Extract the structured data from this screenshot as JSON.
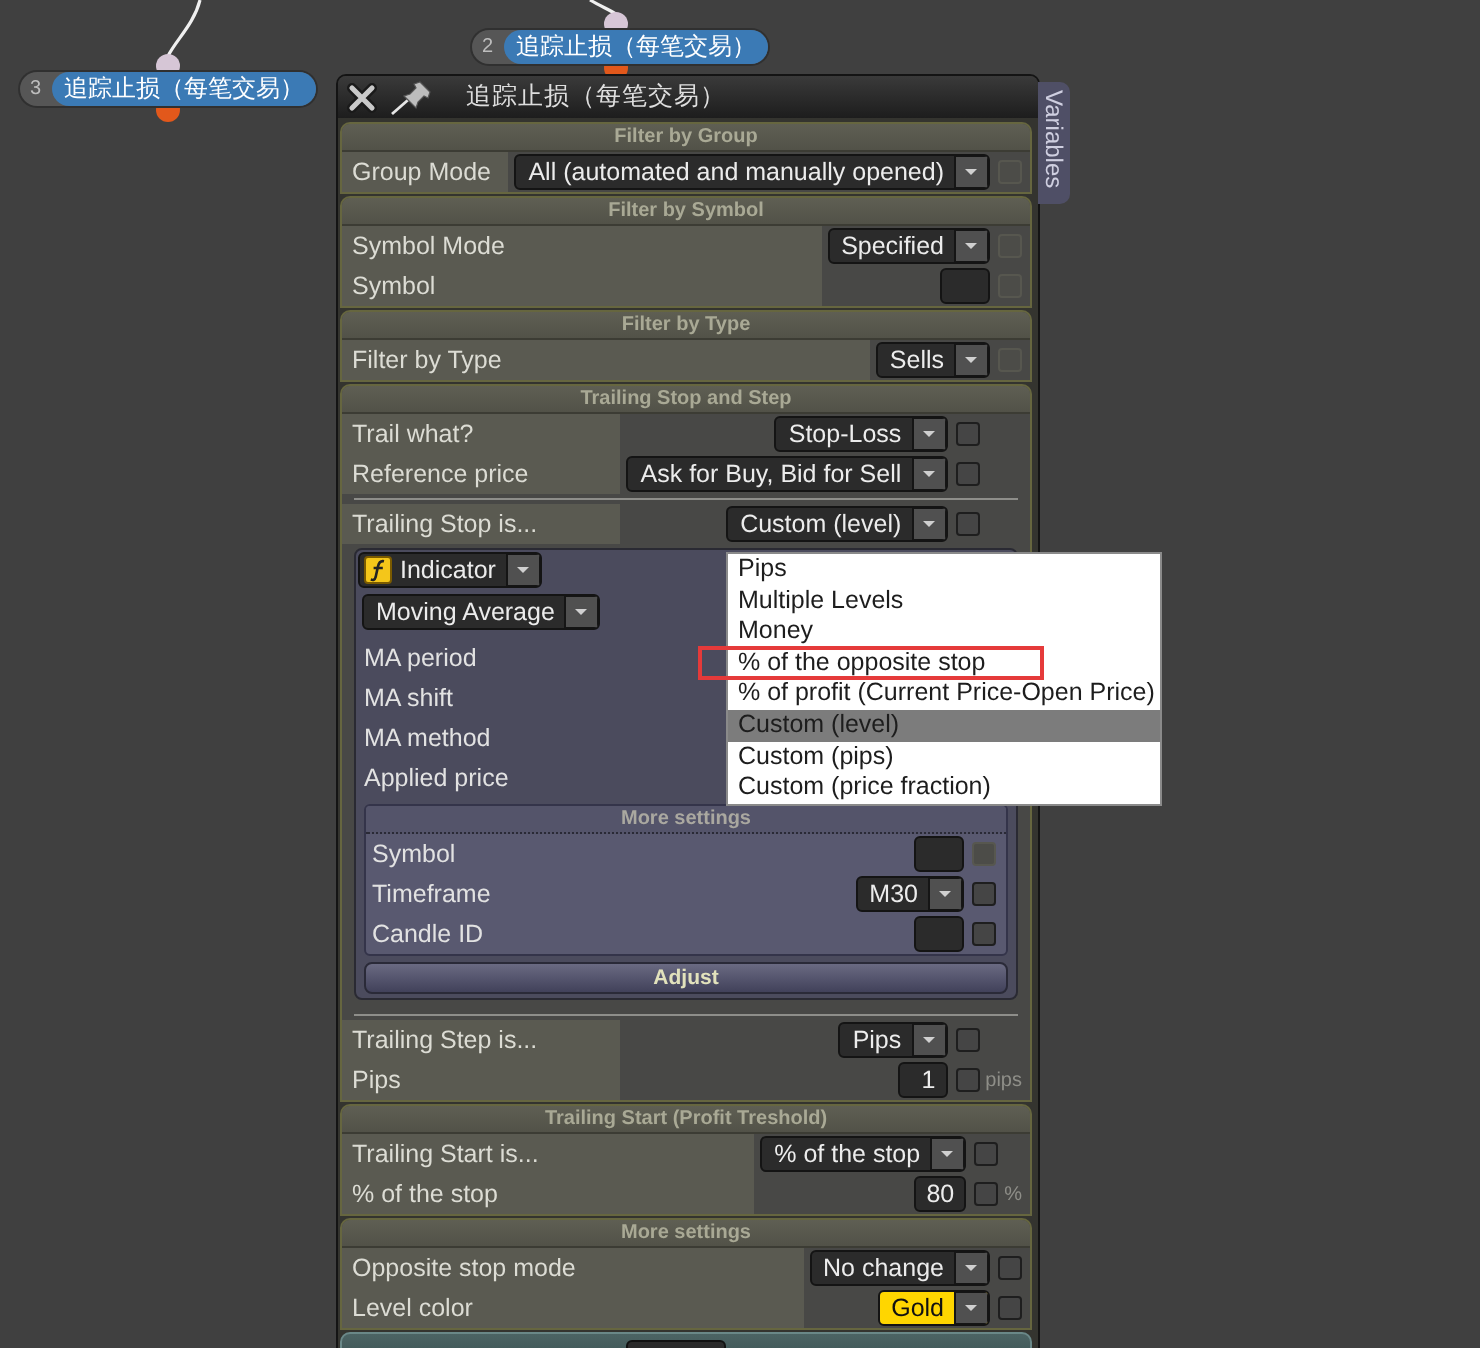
{
  "canvas": {
    "nodes": [
      {
        "number": "3",
        "title": "追踪止损（每笔交易）"
      },
      {
        "number": "2",
        "title": "追踪止损（每笔交易）"
      }
    ]
  },
  "panel": {
    "title": "追踪止损（每笔交易）",
    "side_tab": "Variables",
    "sections": [
      {
        "title": "Filter by Group",
        "rows": [
          {
            "kind": "field",
            "label": "Group Mode",
            "control": {
              "kind": "dropdown",
              "value": "All (automated and manually opened)"
            },
            "checkbox": {
              "checked": false,
              "disabled": true
            }
          }
        ]
      },
      {
        "title": "Filter by Symbol",
        "rows": [
          {
            "kind": "field",
            "label": "Symbol Mode",
            "control": {
              "kind": "dropdown",
              "value": "Specified"
            },
            "checkbox": {
              "checked": false,
              "disabled": true
            }
          },
          {
            "kind": "field",
            "label": "Symbol",
            "control": {
              "kind": "input"
            },
            "checkbox": {
              "checked": false,
              "disabled": true
            }
          }
        ]
      },
      {
        "title": "Filter by Type",
        "rows": [
          {
            "kind": "field",
            "label": "Filter by Type",
            "control": {
              "kind": "dropdown",
              "value": "Sells"
            },
            "checkbox": {
              "checked": false,
              "disabled": true
            }
          }
        ]
      },
      {
        "title": "Trailing Stop and Step",
        "rows": [
          {
            "kind": "field",
            "label": "Trail what?",
            "control": {
              "kind": "dropdown",
              "value": "Stop-Loss"
            },
            "checkbox": {
              "checked": false,
              "disabled": false
            }
          },
          {
            "kind": "field",
            "label": "Reference price",
            "control": {
              "kind": "dropdown",
              "value": "Ask for Buy, Bid for Sell"
            },
            "checkbox": {
              "checked": false,
              "disabled": false
            }
          },
          {
            "kind": "divider"
          },
          {
            "kind": "field",
            "label": "Trailing Stop is...",
            "control": {
              "kind": "dropdown",
              "value": "Custom (level)"
            },
            "checkbox": {
              "checked": false,
              "disabled": false
            }
          },
          {
            "kind": "indicator",
            "source": "Indicator",
            "indicator": "Moving Average",
            "params": [
              "MA period",
              "MA shift",
              "MA method",
              "Applied price"
            ],
            "more_settings": {
              "title": "More settings",
              "rows": [
                {
                  "label": "Symbol",
                  "control": {
                    "kind": "input"
                  },
                  "checkbox": {
                    "checked": false,
                    "disabled": true
                  }
                },
                {
                  "label": "Timeframe",
                  "control": {
                    "kind": "dropdown",
                    "value": "M30"
                  },
                  "checkbox": {
                    "checked": false,
                    "disabled": false
                  }
                },
                {
                  "label": "Candle ID",
                  "control": {
                    "kind": "input"
                  },
                  "checkbox": {
                    "checked": false,
                    "disabled": false
                  }
                }
              ]
            },
            "button": "Adjust"
          },
          {
            "kind": "divider"
          },
          {
            "kind": "field",
            "label": "Trailing Step is...",
            "control": {
              "kind": "dropdown",
              "value": "Pips"
            },
            "checkbox": {
              "checked": false,
              "disabled": false
            }
          },
          {
            "kind": "field",
            "label": "Pips",
            "control": {
              "kind": "input",
              "value": "1"
            },
            "checkbox": {
              "checked": false,
              "disabled": false
            },
            "unit": "pips"
          }
        ]
      },
      {
        "title": "Trailing Start (Profit Treshold)",
        "rows": [
          {
            "kind": "field",
            "label": "Trailing Start is...",
            "control": {
              "kind": "dropdown",
              "value": "% of the stop"
            },
            "checkbox": {
              "checked": false,
              "disabled": false
            }
          },
          {
            "kind": "field",
            "label": "% of the stop",
            "control": {
              "kind": "input",
              "value": "80"
            },
            "checkbox": {
              "checked": false,
              "disabled": false
            },
            "unit": "%"
          }
        ]
      },
      {
        "title": "More settings",
        "rows": [
          {
            "kind": "field",
            "label": "Opposite stop mode",
            "control": {
              "kind": "dropdown",
              "value": "No change"
            },
            "checkbox": {
              "checked": false,
              "disabled": false
            }
          },
          {
            "kind": "field",
            "label": "Level color",
            "control": {
              "kind": "dropdown",
              "value": "Gold",
              "color": "#ffd600"
            },
            "checkbox": {
              "checked": false,
              "disabled": false
            }
          }
        ]
      }
    ]
  },
  "dropdown_list": {
    "options": [
      {
        "label": "Pips",
        "selected": false,
        "highlighted": false
      },
      {
        "label": "Multiple Levels",
        "selected": false,
        "highlighted": false
      },
      {
        "label": "Money",
        "selected": false,
        "highlighted": false
      },
      {
        "label": "% of the opposite stop",
        "selected": false,
        "highlighted": true
      },
      {
        "label": "% of profit (Current Price-Open Price)",
        "selected": false,
        "highlighted": false
      },
      {
        "label": "Custom (level)",
        "selected": true,
        "highlighted": false
      },
      {
        "label": "Custom (pips)",
        "selected": false,
        "highlighted": false
      },
      {
        "label": "Custom (price fraction)",
        "selected": false,
        "highlighted": false
      }
    ]
  }
}
